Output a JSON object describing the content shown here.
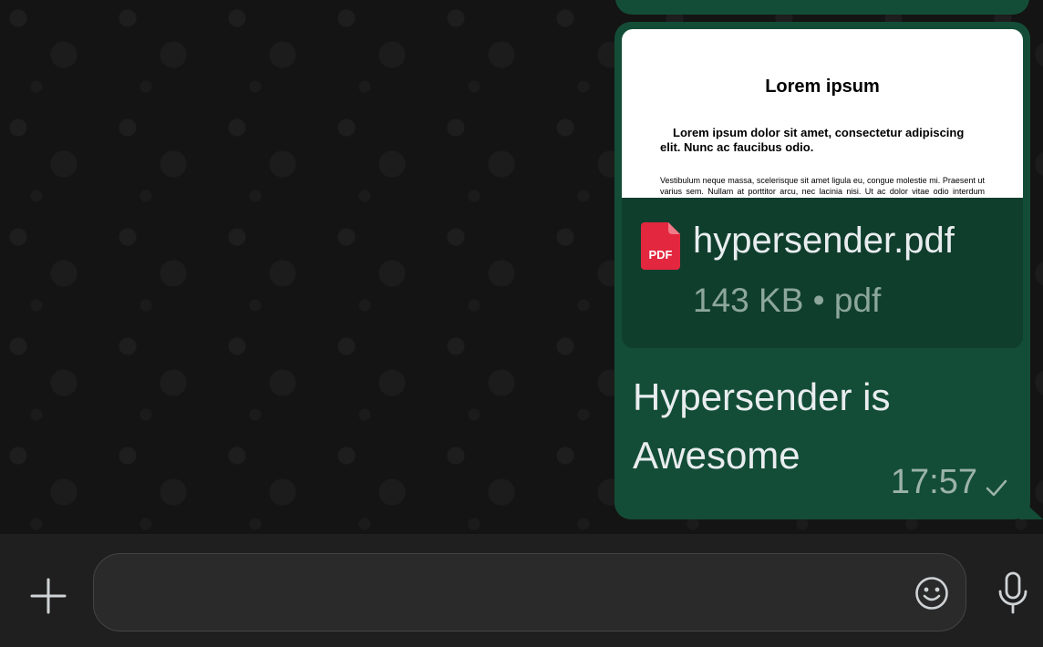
{
  "document": {
    "preview": {
      "title": "Lorem ipsum",
      "lead": "Lorem ipsum dolor sit amet, consectetur adipiscing elit. Nunc ac faucibus odio.",
      "body": "Vestibulum neque massa, scelerisque sit amet ligula eu, congue molestie mi. Praesent ut varius sem. Nullam at porttitor arcu, nec lacinia nisi. Ut ac dolor vitae odio interdum condimentum. Vivamus dapibus sodales ex, vitae malesuada ipsum cursus convallis."
    },
    "file_icon_label": "PDF",
    "file_name": "hypersender.pdf",
    "file_size": "143 KB",
    "separator": "•",
    "file_type": "pdf"
  },
  "message": {
    "text": "Hypersender is Awesome",
    "time": "17:57",
    "status_icon": "check-icon"
  },
  "composer": {
    "placeholder": "",
    "plus_icon": "plus-icon",
    "emoji_icon": "emoji-icon",
    "mic_icon": "mic-icon"
  },
  "colors": {
    "bubble": "#144d37",
    "file_card": "#103e2d",
    "pdf_red": "#e2273f",
    "composer": "#1f1f1f"
  }
}
